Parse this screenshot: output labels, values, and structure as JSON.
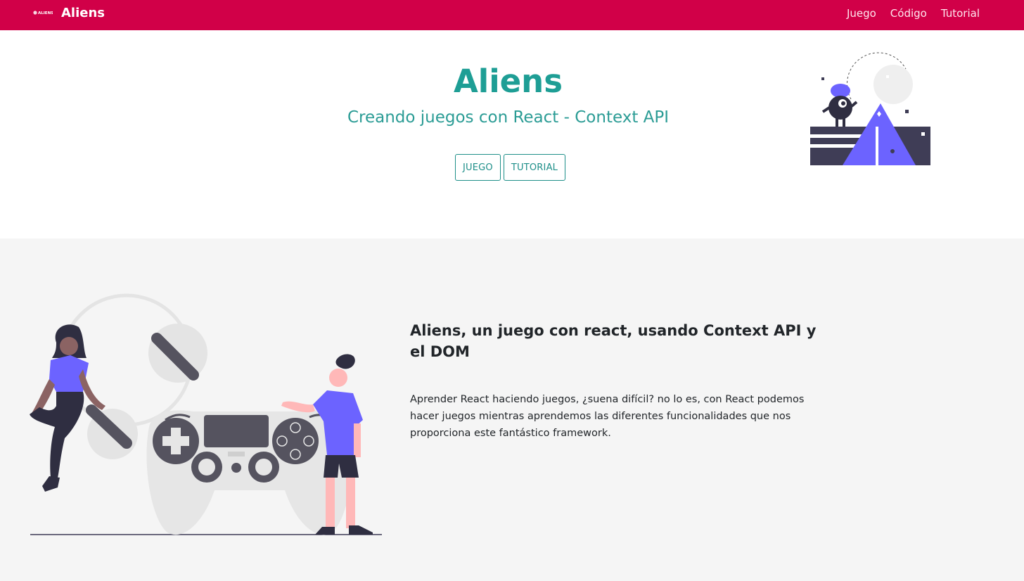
{
  "navbar": {
    "logo_text": "ALIENS",
    "brand": "Aliens",
    "links": [
      "Juego",
      "Código",
      "Tutorial"
    ],
    "bg_color": "#d10048"
  },
  "hero": {
    "title": "Aliens",
    "subtitle": "Creando juegos con React - Context API",
    "buttons": [
      "JUEGO",
      "TUTORIAL"
    ],
    "accent_color": "#1e9e95",
    "illustration": "alien-pyramid-illustration"
  },
  "feature": {
    "heading": "Aliens, un juego con react, usando Context API y el DOM",
    "text": "Aprender React haciendo juegos, ¿suena difícil? no lo es, con React podemos hacer juegos mientras aprendemos las diferentes funcionalidades que nos proporciona este fantástico framework.",
    "illustration": "gamepad-people-illustration",
    "bg_color": "#f5f5f5"
  }
}
